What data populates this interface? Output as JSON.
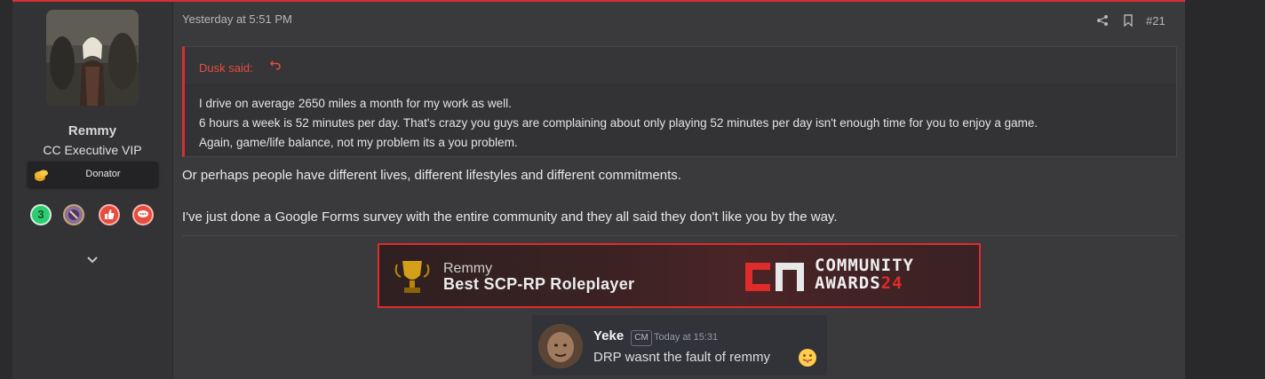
{
  "user": {
    "name": "Remmy",
    "title": "CC Executive VIP",
    "banner": "Donator",
    "trophy_count": "3"
  },
  "post": {
    "date": "Yesterday at 5:51 PM",
    "number": "#21",
    "quote": {
      "author_label": "Dusk said:",
      "lines": [
        "I drive on average 2650 miles a month for my work as well.",
        "6 hours a week is 52 minutes per day. That's crazy you guys are complaining about only playing 52 minutes per day isn't enough time for you to enjoy a game.",
        "Again, game/life balance, not my problem its a you problem."
      ]
    },
    "body": [
      "Or perhaps people have different lives, different lifestyles and different commitments.",
      "I've just done a Google Forms survey with the entire community and they all said they don't like you by the way."
    ]
  },
  "signature": {
    "award": {
      "name": "Remmy",
      "title": "Best SCP-RP Roleplayer",
      "brand_line1": "COMMUNITY",
      "brand_line2": "AWARDS",
      "brand_year": "24"
    },
    "discord": {
      "username": "Yeke",
      "badge": "CM",
      "time": "Today at 15:31",
      "message": "DRP wasnt the fault of remmy"
    }
  },
  "colors": {
    "accent": "#d63031",
    "quote_author": "#e74c3c",
    "trophy_green": "#27ae60",
    "trophy_purple": "#6c4a8a",
    "trophy_red": "#e74c3c"
  },
  "icons": [
    "share-icon",
    "bookmark-icon",
    "expand-quote-icon",
    "chevron-down-icon",
    "coins-icon",
    "trophy-cup-icon"
  ]
}
